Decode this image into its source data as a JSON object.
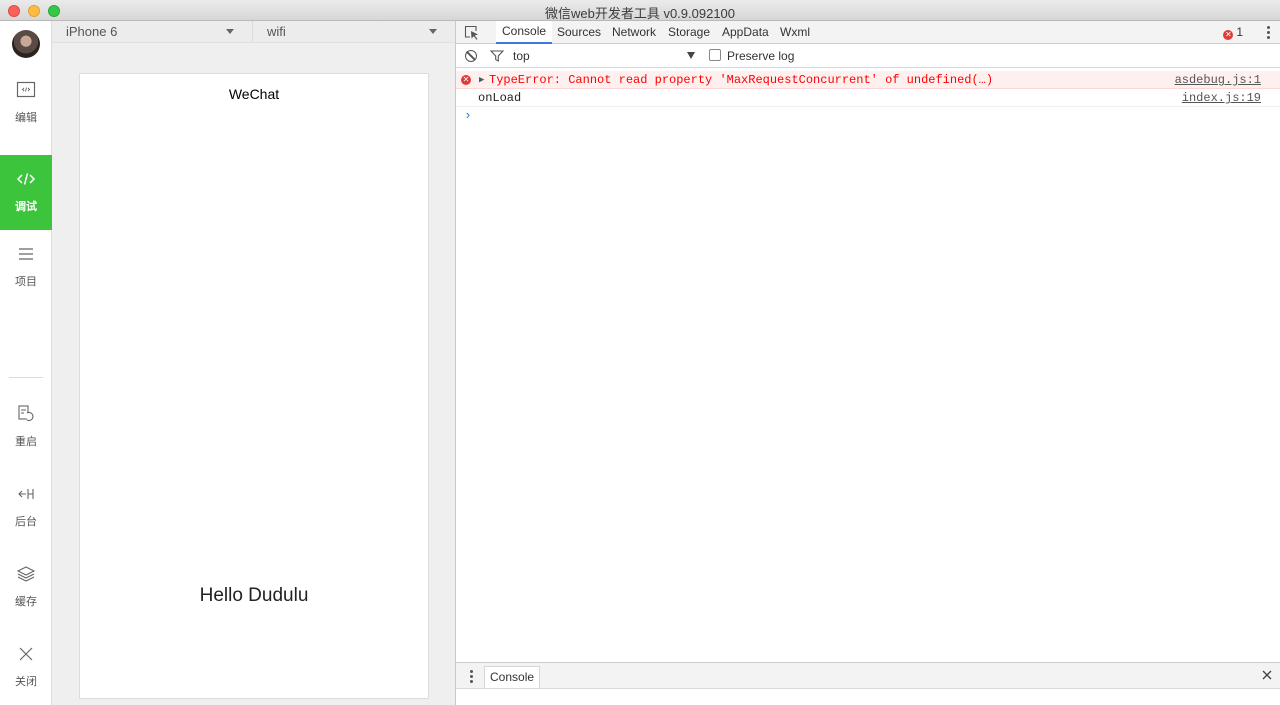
{
  "window": {
    "title": "微信web开发者工具 v0.9.092100"
  },
  "sidebar": {
    "items": [
      {
        "label": "编辑",
        "icon": "code-window-icon"
      },
      {
        "label": "调试",
        "icon": "code-brackets-icon",
        "active": true
      },
      {
        "label": "项目",
        "icon": "menu-lines-icon"
      },
      {
        "label": "重启",
        "icon": "restart-icon"
      },
      {
        "label": "后台",
        "icon": "background-icon"
      },
      {
        "label": "缓存",
        "icon": "layers-icon"
      },
      {
        "label": "关闭",
        "icon": "close-icon"
      }
    ],
    "active_color": "#3cc43c"
  },
  "simulator": {
    "device": "iPhone 6",
    "network": "wifi",
    "nav_title": "WeChat",
    "content_text": "Hello Dudulu"
  },
  "devtools": {
    "tabs": [
      "Console",
      "Sources",
      "Network",
      "Storage",
      "AppData",
      "Wxml"
    ],
    "active_tab": "Console",
    "error_count": "1",
    "filter": {
      "context": "top",
      "preserve_log_label": "Preserve log"
    },
    "logs": [
      {
        "level": "error",
        "message": "TypeError: Cannot read property 'MaxRequestConcurrent' of undefined(…)",
        "source": "asdebug.js:1"
      },
      {
        "level": "log",
        "message": "onLoad",
        "source": "index.js:19"
      }
    ],
    "prompt": "›",
    "drawer": {
      "tab_label": "Console"
    },
    "accent_color": "#3879d9",
    "error_color": "#ff0000"
  }
}
